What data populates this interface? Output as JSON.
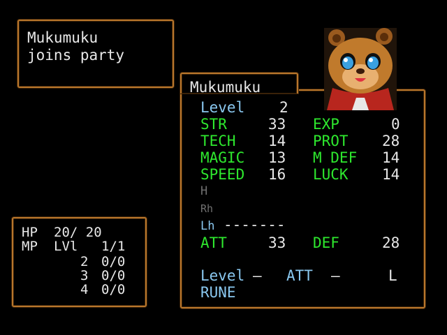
{
  "message": {
    "line1": "Mukumuku",
    "line2": "joins party"
  },
  "character": {
    "name": "Mukumuku",
    "level_label": "Level",
    "level_value": "2",
    "stats_left": [
      {
        "label": "STR",
        "value": "33"
      },
      {
        "label": "TECH",
        "value": "14"
      },
      {
        "label": "MAGIC",
        "value": "13"
      },
      {
        "label": "SPEED",
        "value": "16"
      }
    ],
    "stats_right": [
      {
        "label": "EXP",
        "value": "0"
      },
      {
        "label": "PROT",
        "value": "28"
      },
      {
        "label": "M DEF",
        "value": "14"
      },
      {
        "label": "LUCK",
        "value": "14"
      }
    ],
    "equip": {
      "head_label": "H",
      "right_hand_label": "Rh",
      "left_hand_label": "Lh",
      "left_hand_value": "-------"
    },
    "att_label": "ATT",
    "att_value": "33",
    "def_label": "DEF",
    "def_value": "28",
    "rune": {
      "level_label": "Level",
      "level_value": "—",
      "att_label": "ATT",
      "att_value": "—",
      "slot_label": "L",
      "rune_label": "RUNE"
    }
  },
  "hp_panel": {
    "hp_label": "HP",
    "hp_value": "20/ 20",
    "mp_label": "MP",
    "lvl_label": "LVl",
    "lvl_value": "1/1",
    "rows": [
      {
        "level": "2",
        "value": "0/0"
      },
      {
        "level": "3",
        "value": "0/0"
      },
      {
        "level": "4",
        "value": "0/0"
      }
    ]
  },
  "colors": {
    "border": "#b8762c",
    "label_green": "#2ee82e",
    "label_cyan": "#8ac8f0",
    "text_white": "#e8e8e8",
    "disabled_gray": "#707070"
  },
  "portrait_icon": "bear-cub-portrait"
}
